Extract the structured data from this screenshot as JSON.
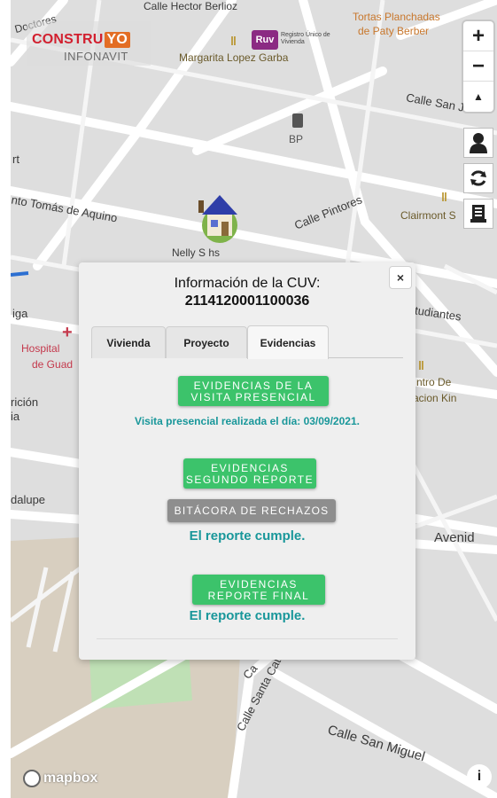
{
  "map": {
    "streets": [
      {
        "id": "hector-berlioz",
        "text": "Calle Hector Berlioz"
      },
      {
        "id": "doctores",
        "text": "Doctores"
      },
      {
        "id": "tortas",
        "text": "Tortas Planchadas"
      },
      {
        "id": "paty",
        "text": "de Paty Berber"
      },
      {
        "id": "margarita",
        "text": "Margarita Lopez Garba"
      },
      {
        "id": "calle-san",
        "text": "Calle San J"
      },
      {
        "id": "bp",
        "text": "BP"
      },
      {
        "id": "rt",
        "text": "rt"
      },
      {
        "id": "tomas",
        "text": "nto Tomás de Aquino"
      },
      {
        "id": "pintores",
        "text": "Calle Pintores"
      },
      {
        "id": "clairmont",
        "text": "Clairmont S"
      },
      {
        "id": "iga",
        "text": "iga"
      },
      {
        "id": "tudiantes",
        "text": "tudiantes"
      },
      {
        "id": "hospital",
        "text": "Hospital"
      },
      {
        "id": "guad",
        "text": "de Guad"
      },
      {
        "id": "ricion",
        "text": "rición"
      },
      {
        "id": "ia",
        "text": "ia"
      },
      {
        "id": "centro",
        "text": "ntro De"
      },
      {
        "id": "kin",
        "text": "acion Kin"
      },
      {
        "id": "dalupe",
        "text": "dalupe"
      },
      {
        "id": "avenid",
        "text": "Avenid"
      },
      {
        "id": "catalina",
        "text": "Calle Santa Catalina de S"
      },
      {
        "id": "calle-c",
        "text": "Ca"
      },
      {
        "id": "san-miguel",
        "text": "Calle San Miguel"
      }
    ],
    "marker_label": "Nelly S  hs",
    "mapbox_label": "mapbox"
  },
  "logos": {
    "construyo_main": "CONSTRU",
    "construyo_yo": "YO",
    "construyo_sub": "INFONAVIT",
    "ruv_box": "Ruv",
    "ruv_text": "Registro Único de Vivienda"
  },
  "controls": {
    "zoom_in": "+",
    "zoom_out": "−",
    "compass": "▲"
  },
  "modal": {
    "close": "×",
    "title_line": "Información de la CUV:",
    "title_number": "2114120001100036",
    "tabs": [
      {
        "label": "Vivienda",
        "active": false
      },
      {
        "label": "Proyecto",
        "active": false
      },
      {
        "label": "Evidencias",
        "active": true
      }
    ],
    "btn_visita_line1": "EVIDENCIAS DE LA",
    "btn_visita_line2": "VISITA PRESENCIAL",
    "visita_msg": "Visita presencial realizada el día: 03/09/2021.",
    "btn_segundo_line1": "EVIDENCIAS",
    "btn_segundo_line2": "SEGUNDO REPORTE",
    "btn_rechazos": "BITÁCORA DE RECHAZOS",
    "segundo_msg": "El reporte cumple.",
    "btn_final_line1": "EVIDENCIAS",
    "btn_final_line2": "REPORTE FINAL",
    "final_msg": "El reporte cumple."
  },
  "colors": {
    "green_button": "#3cc36b",
    "gray_button": "#8e8e8e",
    "message_teal": "#19979a"
  }
}
